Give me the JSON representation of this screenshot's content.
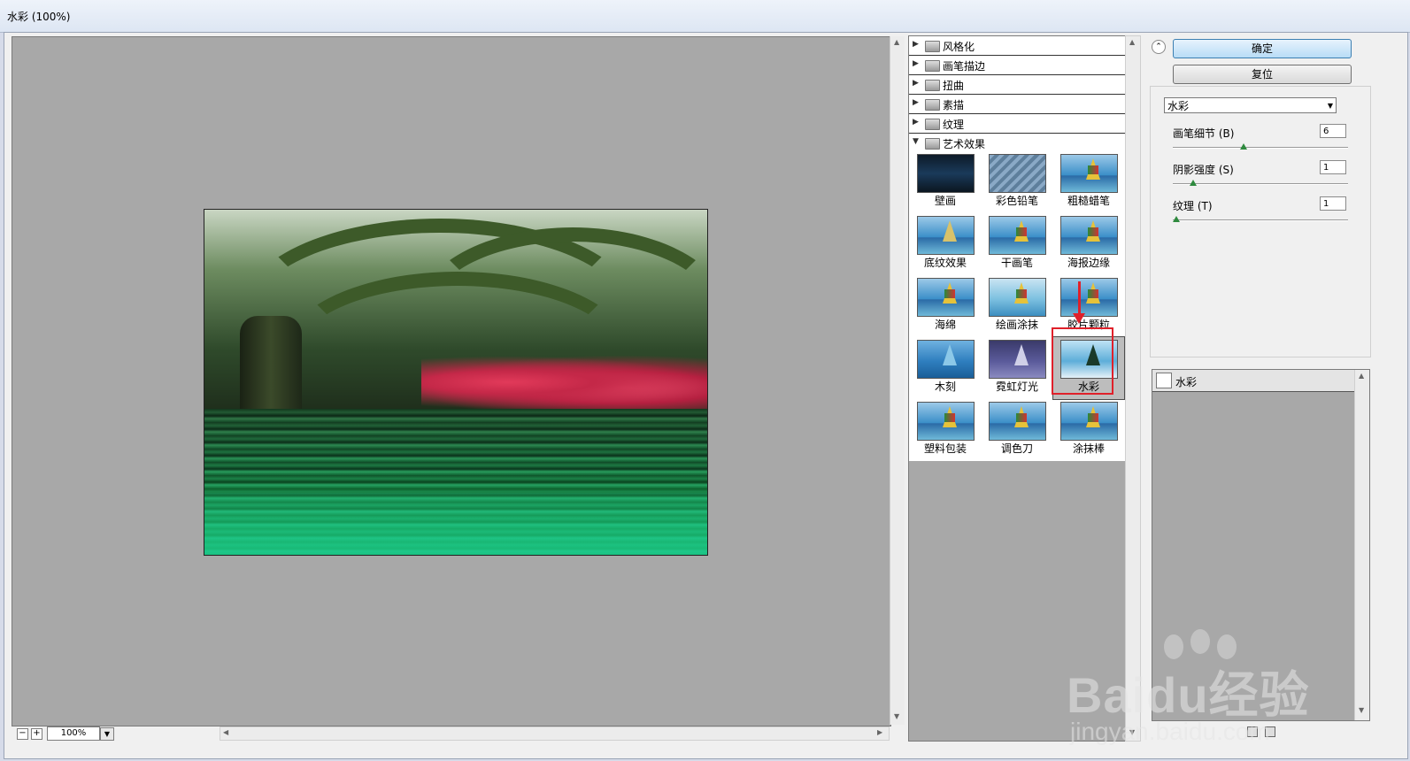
{
  "window": {
    "title": "水彩 (100%)"
  },
  "preview": {
    "zoom": "100%",
    "zoom_out": "−",
    "zoom_in": "+"
  },
  "gallery": {
    "categories": [
      {
        "label": "风格化",
        "expanded": false
      },
      {
        "label": "画笔描边",
        "expanded": false
      },
      {
        "label": "扭曲",
        "expanded": false
      },
      {
        "label": "素描",
        "expanded": false
      },
      {
        "label": "纹理",
        "expanded": false
      },
      {
        "label": "艺术效果",
        "expanded": true
      }
    ],
    "filters": [
      {
        "label": "壁画"
      },
      {
        "label": "彩色铅笔"
      },
      {
        "label": "粗糙蜡笔"
      },
      {
        "label": "底纹效果"
      },
      {
        "label": "干画笔"
      },
      {
        "label": "海报边缘"
      },
      {
        "label": "海绵"
      },
      {
        "label": "绘画涂抹"
      },
      {
        "label": "胶片颗粒"
      },
      {
        "label": "木刻"
      },
      {
        "label": "霓虹灯光"
      },
      {
        "label": "水彩",
        "selected": true
      },
      {
        "label": "塑料包装"
      },
      {
        "label": "调色刀"
      },
      {
        "label": "涂抹棒"
      }
    ]
  },
  "panel": {
    "ok_label": "确定",
    "reset_label": "复位",
    "filter_select": "水彩",
    "params": [
      {
        "label": "画笔细节 (B)",
        "value": "6",
        "fraction": 0.4
      },
      {
        "label": "阴影强度 (S)",
        "value": "1",
        "fraction": 0.1
      },
      {
        "label": "纹理 (T)",
        "value": "1",
        "fraction": 0.0
      }
    ]
  },
  "layers": [
    {
      "label": "水彩"
    }
  ],
  "watermark": {
    "text": "Baidu经验",
    "url": "jingyan.baidu.com"
  },
  "colors": {
    "accent": "#3c7fb1",
    "highlight": "#e0202a"
  }
}
